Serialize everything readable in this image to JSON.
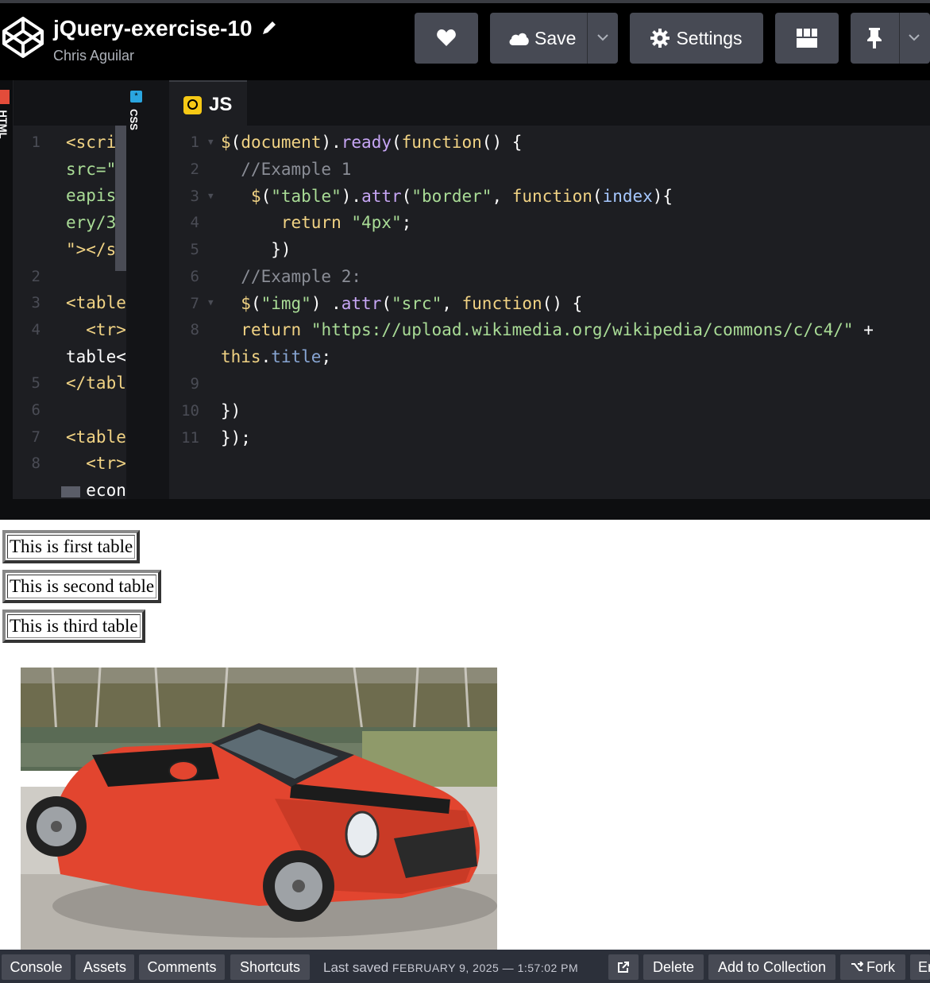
{
  "header": {
    "title": "jQuery-exercise-10",
    "author": "Chris Aguilar",
    "save_label": "Save",
    "settings_label": "Settings"
  },
  "editors": {
    "html_label": "HTML",
    "css_label": "CSS",
    "js_label": "JS",
    "html_lines": [
      {
        "n": "1",
        "text": "<scri"
      },
      {
        "n": "",
        "text": "src=\""
      },
      {
        "n": "",
        "text": "eapis"
      },
      {
        "n": "",
        "text": "ery/3"
      },
      {
        "n": "",
        "text": "\"></s"
      },
      {
        "n": "2",
        "text": ""
      },
      {
        "n": "3",
        "text": "<table"
      },
      {
        "n": "4",
        "text": "  <tr>"
      },
      {
        "n": "",
        "text": "table<"
      },
      {
        "n": "5",
        "text": "</tabl"
      },
      {
        "n": "6",
        "text": ""
      },
      {
        "n": "7",
        "text": "<table"
      },
      {
        "n": "8",
        "text": "  <tr>"
      },
      {
        "n": "",
        "text": "  econd"
      }
    ],
    "js_line_numbers": [
      "1",
      "2",
      "3",
      "4",
      "5",
      "6",
      "7",
      "8",
      "",
      "9",
      "10",
      "11"
    ]
  },
  "preview": {
    "tables": [
      "This is first table",
      "This is second table",
      "This is third table"
    ]
  },
  "footer": {
    "console": "Console",
    "assets": "Assets",
    "comments": "Comments",
    "shortcuts": "Shortcuts",
    "last_saved_label": "Last saved",
    "last_saved_date": "FEBRUARY 9, 2025 — 1:57:02 PM",
    "delete": "Delete",
    "add_to_collection": "Add to Collection",
    "fork": "Fork",
    "embed": "Er"
  },
  "colors": {
    "header_bg": "#000000",
    "button_bg": "#474a54",
    "editor_bg": "#1d1e22",
    "footer_bg": "#2c303a"
  }
}
